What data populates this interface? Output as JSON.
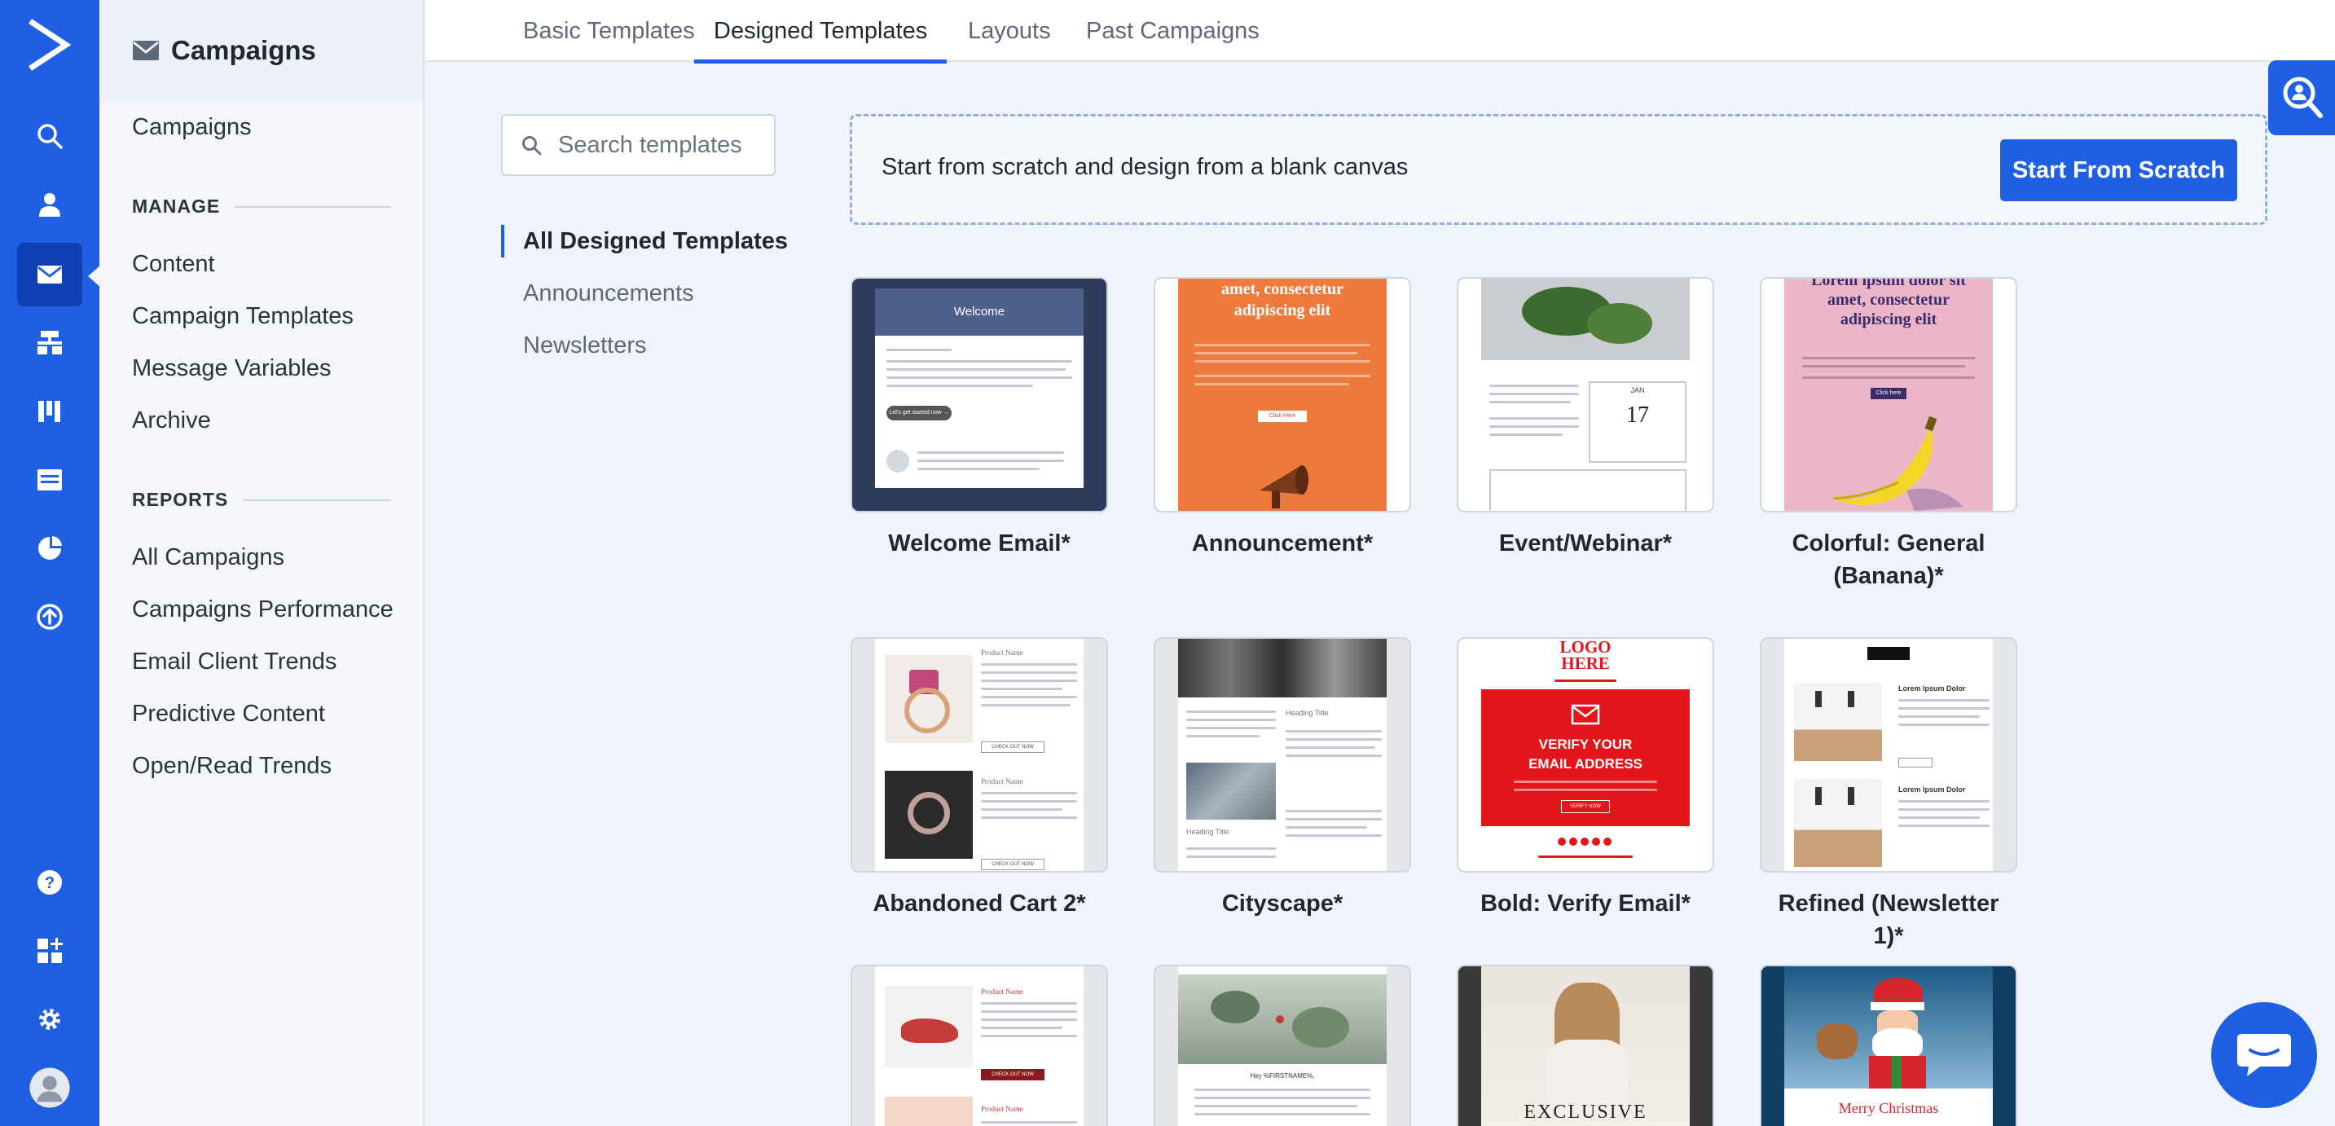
{
  "rail": {
    "icons": [
      "logo-icon",
      "search-icon",
      "contacts-icon",
      "campaigns-icon",
      "automations-icon",
      "deals-icon",
      "website-icon",
      "reports-icon",
      "conversions-icon",
      "help-icon",
      "apps-icon",
      "settings-icon",
      "avatar-icon"
    ],
    "active": "campaigns-icon"
  },
  "sidebar": {
    "title": "Campaigns",
    "top_item": "Campaigns",
    "manage": {
      "heading": "MANAGE",
      "items": [
        "Content",
        "Campaign Templates",
        "Message Variables",
        "Archive"
      ]
    },
    "reports": {
      "heading": "REPORTS",
      "items": [
        "All Campaigns",
        "Campaigns Performance",
        "Email Client Trends",
        "Predictive Content",
        "Open/Read Trends"
      ]
    }
  },
  "tabs": {
    "items": [
      "Basic Templates",
      "Designed Templates",
      "Layouts",
      "Past Campaigns"
    ],
    "active": "Designed Templates"
  },
  "search": {
    "placeholder": "Search templates"
  },
  "filters": {
    "items": [
      "All Designed Templates",
      "Announcements",
      "Newsletters"
    ],
    "active": "All Designed Templates"
  },
  "scratch": {
    "text": "Start from scratch and design from a blank canvas",
    "button": "Start From Scratch"
  },
  "templates": [
    {
      "name": "Welcome Email*",
      "thumb_text": [
        "Welcome",
        "Let's get started now →"
      ]
    },
    {
      "name": "Announcement*",
      "thumb_text": [
        "amet, consectetur",
        "adipiscing elit",
        "Click Here"
      ]
    },
    {
      "name": "Event/Webinar*",
      "thumb_text": [
        "JAN",
        "17"
      ]
    },
    {
      "name": "Colorful: General (Banana)*",
      "thumb_text": [
        "Lorem ipsum dolor sit",
        "amet, consectetur",
        "adipiscing elit",
        "Click here"
      ]
    },
    {
      "name": "Abandoned Cart 2*",
      "thumb_text": [
        "Product Name",
        "Product Name",
        "CHECK OUT NOW",
        "CHECK OUT NOW"
      ]
    },
    {
      "name": "Cityscape*",
      "thumb_text": [
        "Heading Title",
        "Heading Title"
      ]
    },
    {
      "name": "Bold: Verify Email*",
      "thumb_text": [
        "LOGO",
        "HERE",
        "VERIFY YOUR",
        "EMAIL ADDRESS",
        "VERIFY NOW"
      ]
    },
    {
      "name": "Refined (Newsletter 1)*",
      "thumb_text": [
        "Lorem Ipsum Dolor",
        "Lorem Ipsum Dolor"
      ]
    },
    {
      "name": "",
      "thumb_text": [
        "Product Name",
        "CHECK OUT NOW",
        "Product Name"
      ]
    },
    {
      "name": "",
      "thumb_text": [
        "Hey %FIRSTNAME%,"
      ]
    },
    {
      "name": "",
      "thumb_text": [
        "EXCLUSIVE"
      ]
    },
    {
      "name": "",
      "thumb_text": [
        "Merry Christmas"
      ]
    }
  ],
  "colors": {
    "brand": "#1f5fe3",
    "rail": "#1f5fe3",
    "rail_active": "#0e3fb3",
    "announcement_orange": "#ee7a3b",
    "verify_red": "#e3161b",
    "banana_pink": "#eab6c8",
    "welcome_navy": "#2d3b5c"
  }
}
